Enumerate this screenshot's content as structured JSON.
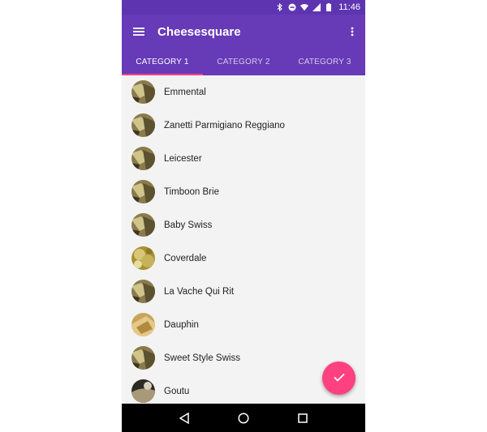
{
  "status_bar": {
    "time": "11:46",
    "icons": [
      "bluetooth-icon",
      "do-not-disturb-icon",
      "wifi-icon",
      "signal-icon",
      "battery-icon"
    ]
  },
  "toolbar": {
    "title": "Cheesesquare",
    "menu_icon": "hamburger-menu-icon",
    "overflow_icon": "more-vert-icon"
  },
  "tabs": [
    {
      "label": "CATEGORY 1",
      "active": true
    },
    {
      "label": "CATEGORY 2",
      "active": false
    },
    {
      "label": "CATEGORY 3",
      "active": false
    }
  ],
  "list": [
    {
      "name": "Emmental"
    },
    {
      "name": "Zanetti Parmigiano Reggiano"
    },
    {
      "name": "Leicester"
    },
    {
      "name": "Timboon Brie"
    },
    {
      "name": "Baby Swiss"
    },
    {
      "name": "Coverdale"
    },
    {
      "name": "La Vache Qui Rit"
    },
    {
      "name": "Dauphin"
    },
    {
      "name": "Sweet Style Swiss"
    },
    {
      "name": "Goutu"
    }
  ],
  "fab": {
    "icon": "check-icon"
  },
  "nav_bar": {
    "icons": [
      "back-icon",
      "home-icon",
      "recents-icon"
    ]
  },
  "colors": {
    "primary": "#673ab7",
    "primary_dark": "#5e35b1",
    "accent": "#ff4081"
  }
}
